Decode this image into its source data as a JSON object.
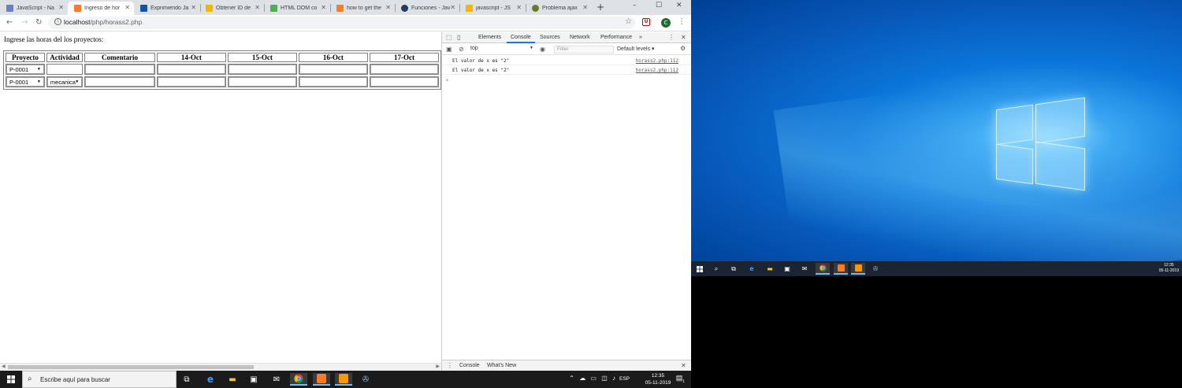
{
  "browser": {
    "tabs": [
      {
        "title": "JavaScript - Na",
        "color": "#6d7fc4"
      },
      {
        "title": "Ingreso de hor",
        "color": "#ff7a2b"
      },
      {
        "title": "Exprimiendo Ja",
        "color": "#1552a8"
      },
      {
        "title": "Obtener ID de",
        "color": "#f4b400"
      },
      {
        "title": "HTML DOM co",
        "color": "#4caf50"
      },
      {
        "title": "how to get the",
        "color": "#f48024"
      },
      {
        "title": "Funciones - Jav",
        "color": "#1f3b5f"
      },
      {
        "title": "javascript - JS",
        "color": "#f4b400"
      },
      {
        "title": "Problema ajax",
        "color": "#6b7a2a"
      }
    ],
    "new_tab": "+",
    "window_controls": {
      "minimize": "–",
      "maximize": "☐",
      "close": "✕"
    },
    "url_host": "localhost",
    "url_path": "/php/horass2.php",
    "avatar_letter": "C",
    "ext_letter": "U"
  },
  "page": {
    "intro": "Ingrese las horas del los proyectos:",
    "headers": [
      "Proyecto",
      "Actividad",
      "Comentario",
      "14-Oct",
      "15-Oct",
      "16-Oct",
      "17-Oct"
    ],
    "rows": [
      {
        "project": "P-0001",
        "activity": ""
      },
      {
        "project": "P-0001",
        "activity": "mecanica"
      }
    ]
  },
  "devtools": {
    "tabs": [
      "Elements",
      "Console",
      "Sources",
      "Network",
      "Performance",
      "»"
    ],
    "context": "top",
    "filter_placeholder": "Filter",
    "levels": "Default levels ▾",
    "logs": [
      {
        "msg": "El valor de x es \"2\"",
        "src": "horass2.php:112"
      },
      {
        "msg": "El valor de x es \"2\"",
        "src": "horass2.php:112"
      }
    ],
    "prompt": "›",
    "drawer_tabs": [
      "Console",
      "What's New"
    ]
  },
  "taskbar": {
    "search_placeholder": "Escribe aquí para buscar",
    "lang": "ESP",
    "time": "12:35",
    "date": "05-11-2019",
    "notif_count": "1"
  }
}
